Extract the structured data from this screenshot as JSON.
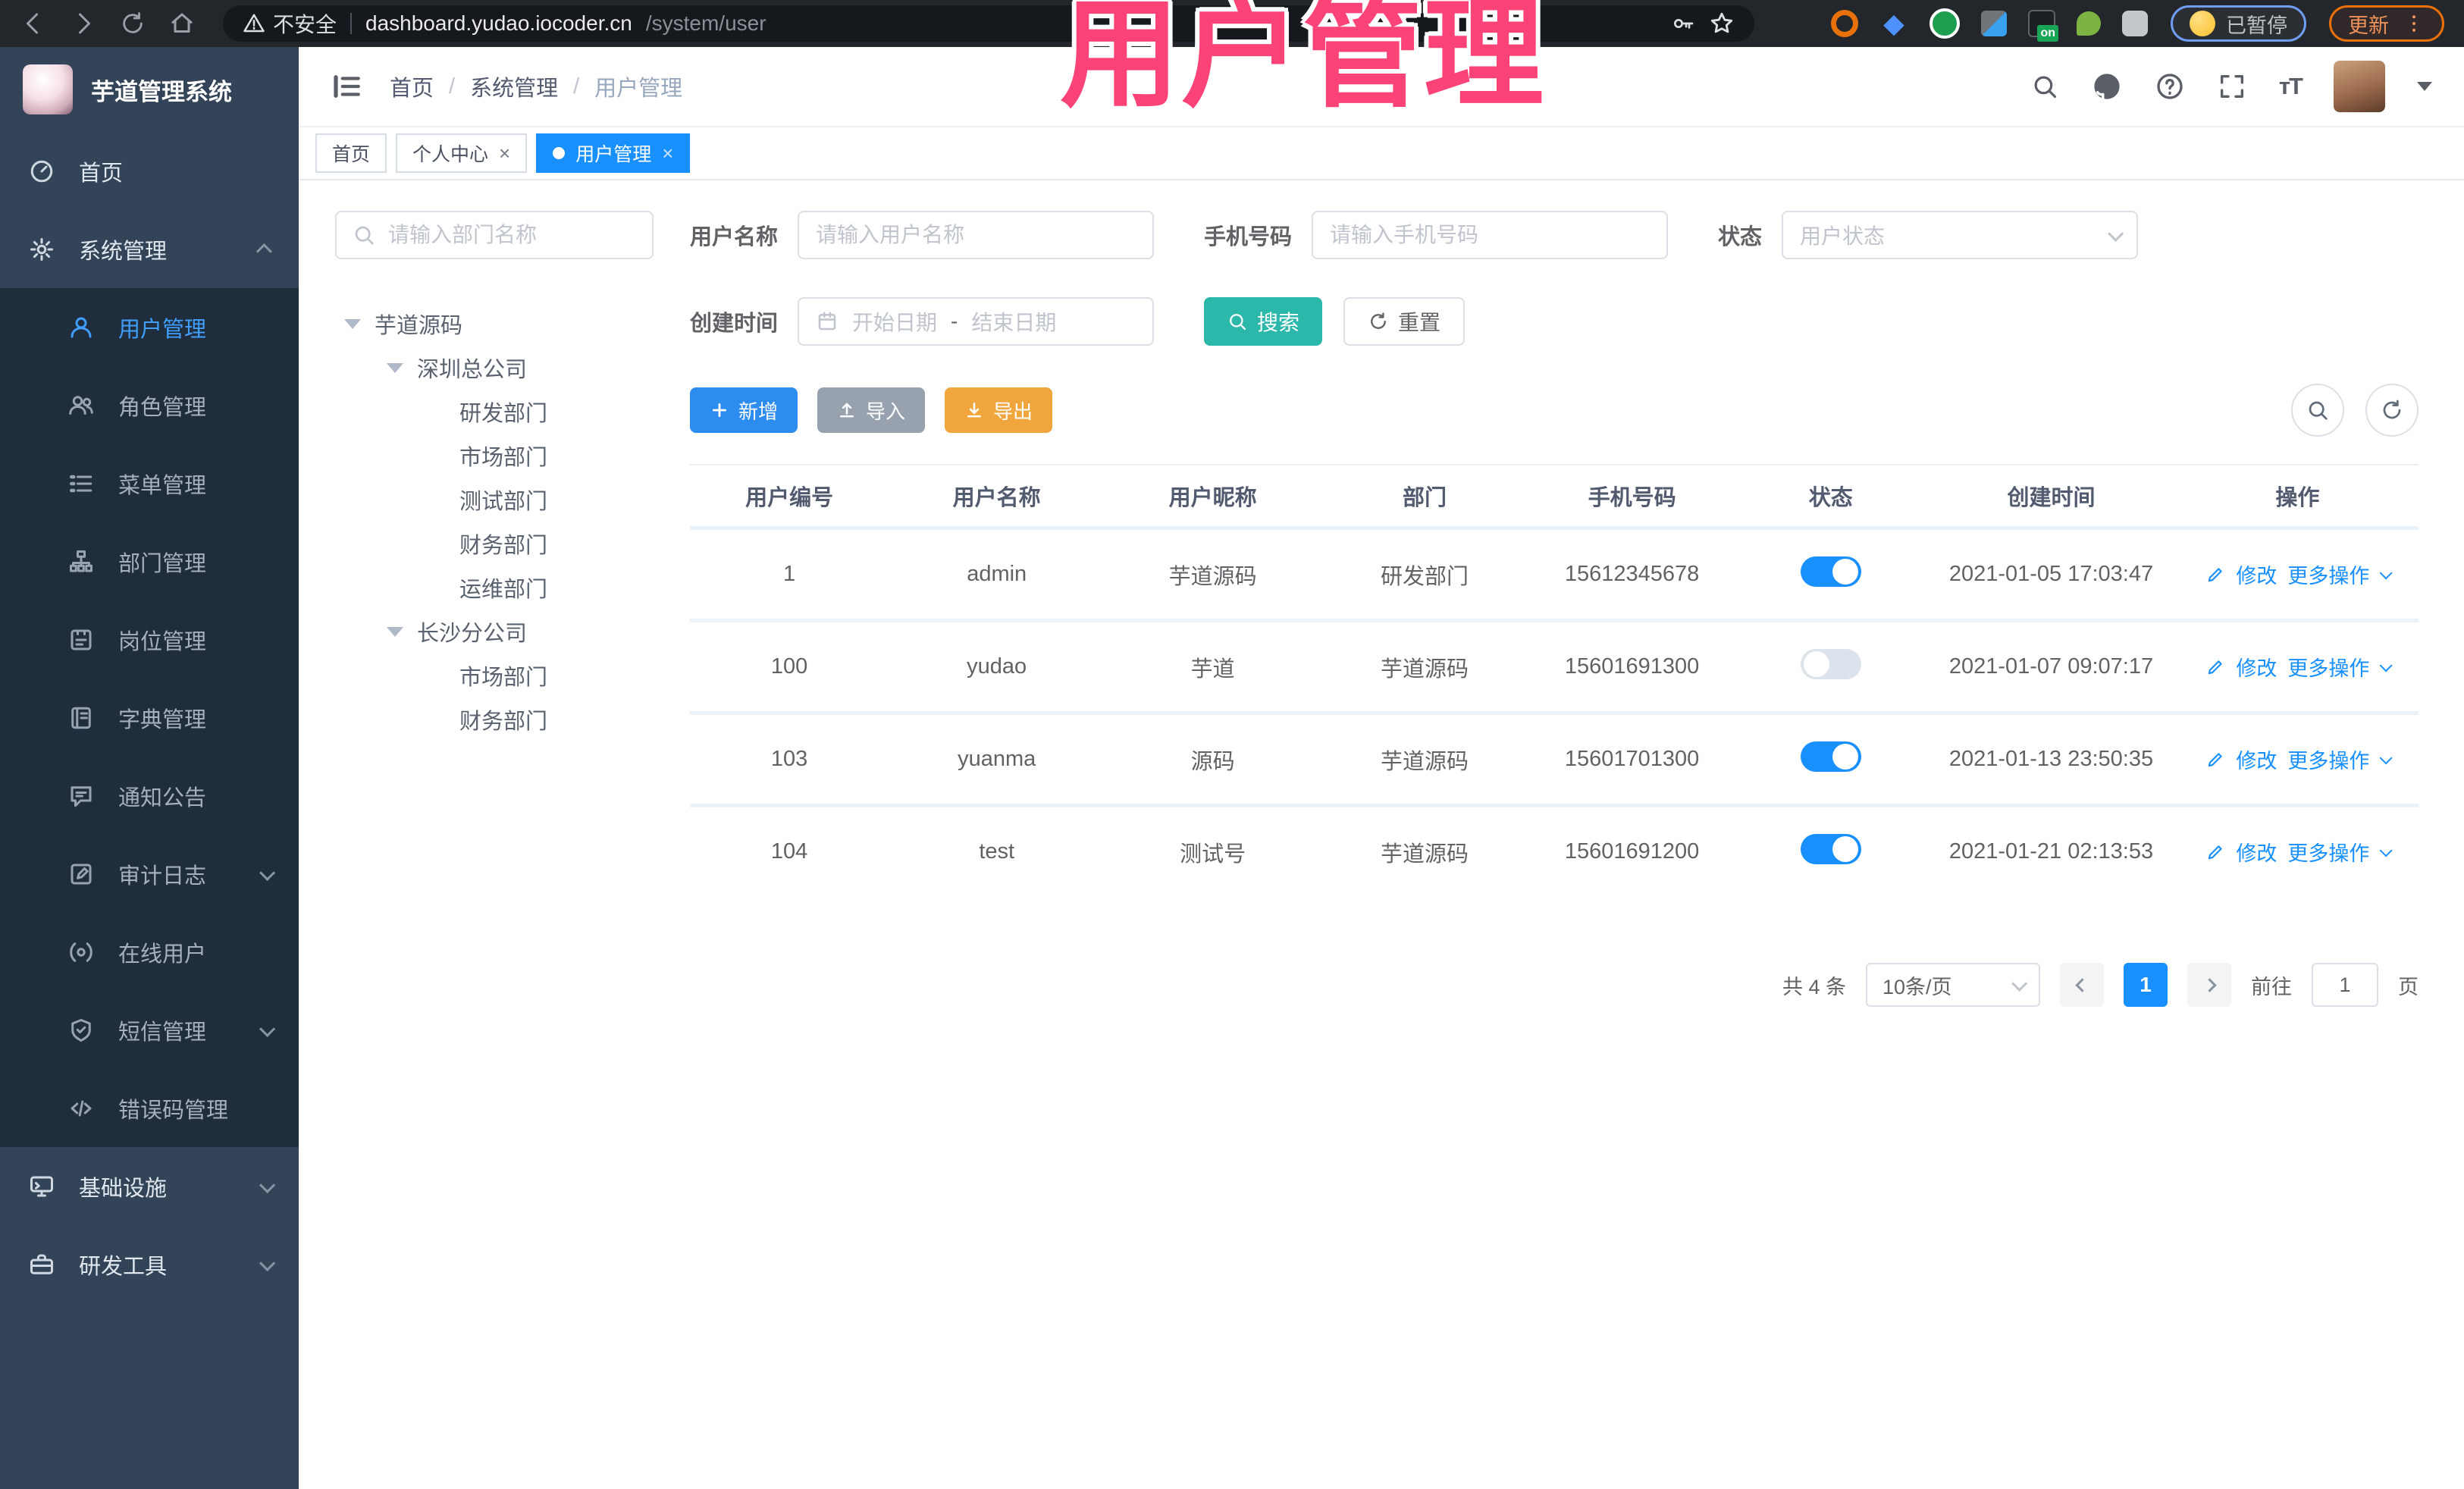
{
  "browser": {
    "security_label": "不安全",
    "url_host": "dashboard.yudao.iocoder.cn",
    "url_path": "/system/user",
    "paused_label": "已暂停",
    "update_label": "更新",
    "extensions": [
      {
        "name": "orange-ring-extension"
      },
      {
        "name": "blue-gem-extension"
      },
      {
        "name": "green-circle-extension"
      },
      {
        "name": "grid-extension"
      },
      {
        "name": "dark-list-extension",
        "badge": "on"
      },
      {
        "name": "green-sprout-extension"
      },
      {
        "name": "puzzle-extension"
      }
    ]
  },
  "overlay_title": "用户管理",
  "sidebar": {
    "title": "芋道管理系统",
    "items": [
      {
        "label": "首页",
        "icon": "dashboard",
        "level": "top"
      },
      {
        "label": "系统管理",
        "icon": "gear",
        "level": "top",
        "arrow": "up"
      },
      {
        "label": "用户管理",
        "icon": "user",
        "level": "sub",
        "active": true
      },
      {
        "label": "角色管理",
        "icon": "users",
        "level": "sub"
      },
      {
        "label": "菜单管理",
        "icon": "listmenu",
        "level": "sub"
      },
      {
        "label": "部门管理",
        "icon": "orgtree",
        "level": "sub"
      },
      {
        "label": "岗位管理",
        "icon": "idbadge",
        "level": "sub"
      },
      {
        "label": "字典管理",
        "icon": "book",
        "level": "sub"
      },
      {
        "label": "通知公告",
        "icon": "chat",
        "level": "sub"
      },
      {
        "label": "审计日志",
        "icon": "editlog",
        "level": "sub",
        "arrow": "down"
      },
      {
        "label": "在线用户",
        "icon": "online",
        "level": "sub"
      },
      {
        "label": "短信管理",
        "icon": "shield",
        "level": "sub",
        "arrow": "down"
      },
      {
        "label": "错误码管理",
        "icon": "code",
        "level": "sub"
      },
      {
        "label": "基础设施",
        "icon": "infra",
        "level": "top",
        "arrow": "down"
      },
      {
        "label": "研发工具",
        "icon": "tools",
        "level": "top",
        "arrow": "down"
      }
    ]
  },
  "header": {
    "breadcrumb": [
      "首页",
      "系统管理",
      "用户管理"
    ]
  },
  "tabs": [
    {
      "label": "首页",
      "closable": false,
      "active": false
    },
    {
      "label": "个人中心",
      "closable": true,
      "active": false
    },
    {
      "label": "用户管理",
      "closable": true,
      "active": true
    }
  ],
  "tree": {
    "search_placeholder": "请输入部门名称",
    "nodes": [
      {
        "label": "芋道源码",
        "level": 0,
        "expandable": true
      },
      {
        "label": "深圳总公司",
        "level": 1,
        "expandable": true
      },
      {
        "label": "研发部门",
        "level": 2,
        "expandable": false
      },
      {
        "label": "市场部门",
        "level": 2,
        "expandable": false
      },
      {
        "label": "测试部门",
        "level": 2,
        "expandable": false
      },
      {
        "label": "财务部门",
        "level": 2,
        "expandable": false
      },
      {
        "label": "运维部门",
        "level": 2,
        "expandable": false
      },
      {
        "label": "长沙分公司",
        "level": 1,
        "expandable": true
      },
      {
        "label": "市场部门",
        "level": 2,
        "expandable": false
      },
      {
        "label": "财务部门",
        "level": 2,
        "expandable": false
      }
    ]
  },
  "filters": {
    "username_label": "用户名称",
    "username_placeholder": "请输入用户名称",
    "mobile_label": "手机号码",
    "mobile_placeholder": "请输入手机号码",
    "status_label": "状态",
    "status_placeholder": "用户状态",
    "created_label": "创建时间",
    "date_start_placeholder": "开始日期",
    "date_separator": "-",
    "date_end_placeholder": "结束日期",
    "search_label": "搜索",
    "reset_label": "重置"
  },
  "toolbar": {
    "add_label": "新增",
    "import_label": "导入",
    "export_label": "导出"
  },
  "table": {
    "columns": [
      "用户编号",
      "用户名称",
      "用户昵称",
      "部门",
      "手机号码",
      "状态",
      "创建时间",
      "操作"
    ],
    "edit_label": "修改",
    "more_label": "更多操作",
    "rows": [
      {
        "id": "1",
        "username": "admin",
        "nickname": "芋道源码",
        "dept": "研发部门",
        "mobile": "15612345678",
        "status": true,
        "created": "2021-01-05 17:03:47"
      },
      {
        "id": "100",
        "username": "yudao",
        "nickname": "芋道",
        "dept": "芋道源码",
        "mobile": "15601691300",
        "status": false,
        "created": "2021-01-07 09:07:17"
      },
      {
        "id": "103",
        "username": "yuanma",
        "nickname": "源码",
        "dept": "芋道源码",
        "mobile": "15601701300",
        "status": true,
        "created": "2021-01-13 23:50:35"
      },
      {
        "id": "104",
        "username": "test",
        "nickname": "测试号",
        "dept": "芋道源码",
        "mobile": "15601691200",
        "status": true,
        "created": "2021-01-21 02:13:53"
      }
    ]
  },
  "pagination": {
    "total": "共 4 条",
    "page_size": "10条/页",
    "current_page": "1",
    "goto_label": "前往",
    "goto_value": "1",
    "page_unit": "页"
  },
  "colors": {
    "primary": "#1890ff",
    "menu_active": "#409eff",
    "sidebar_bg": "#344458",
    "submenu_bg": "#1f2d3d",
    "search_button": "#2bb8aa",
    "add_button": "#2d8cf0",
    "import_button": "#98a2ae",
    "export_button": "#f0a63c",
    "overlay_text": "#fb4377"
  }
}
